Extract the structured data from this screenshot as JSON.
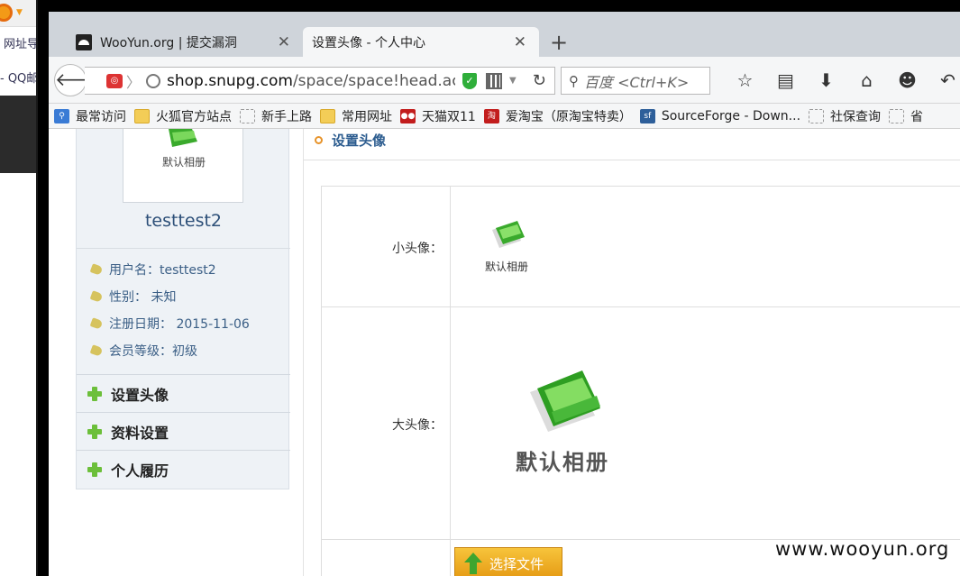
{
  "background_window": {
    "line1": "网址导",
    "line2": "- QQ邮"
  },
  "tabs": [
    {
      "label": "WooYun.org | 提交漏洞",
      "active": false
    },
    {
      "label": "设置头像 - 个人中心",
      "active": true
    }
  ],
  "navbar": {
    "url_host": "shop.snupg.com",
    "url_path": "/space/space!head.act",
    "search_placeholder": "百度 <Ctrl+K>"
  },
  "bookmarks": [
    {
      "label": "最常访问",
      "icon": "search-icon"
    },
    {
      "label": "火狐官方站点",
      "icon": "folder-icon"
    },
    {
      "label": "新手上路",
      "icon": "page-icon"
    },
    {
      "label": "常用网址",
      "icon": "folder-icon"
    },
    {
      "label": "天猫双11",
      "icon": "tmall-icon"
    },
    {
      "label": "爱淘宝（原淘宝特卖）",
      "icon": "taobao-icon"
    },
    {
      "label": "SourceForge - Down...",
      "icon": "sourceforge-icon"
    },
    {
      "label": "社保查询",
      "icon": "page-icon"
    },
    {
      "label": "省",
      "icon": "page-icon"
    }
  ],
  "sidebar": {
    "avatar_caption": "默认相册",
    "username": "testtest2",
    "info": [
      "用户名：testtest2",
      "性别： 未知",
      "注册日期： 2015-11-06",
      "会员等级：初级"
    ],
    "menu": [
      "设置头像",
      "资料设置",
      "个人履历"
    ]
  },
  "main": {
    "section_title": "设置头像",
    "small_label": "小头像：",
    "small_caption": "默认相册",
    "big_label": "大头像：",
    "big_caption": "默认相册",
    "upload_label": "选择文件"
  },
  "watermark": "www.wooyun.org",
  "colors": {
    "accent_green": "#6cbf3a",
    "link_blue": "#2c5c8f",
    "upload_orange": "#e59a14"
  }
}
